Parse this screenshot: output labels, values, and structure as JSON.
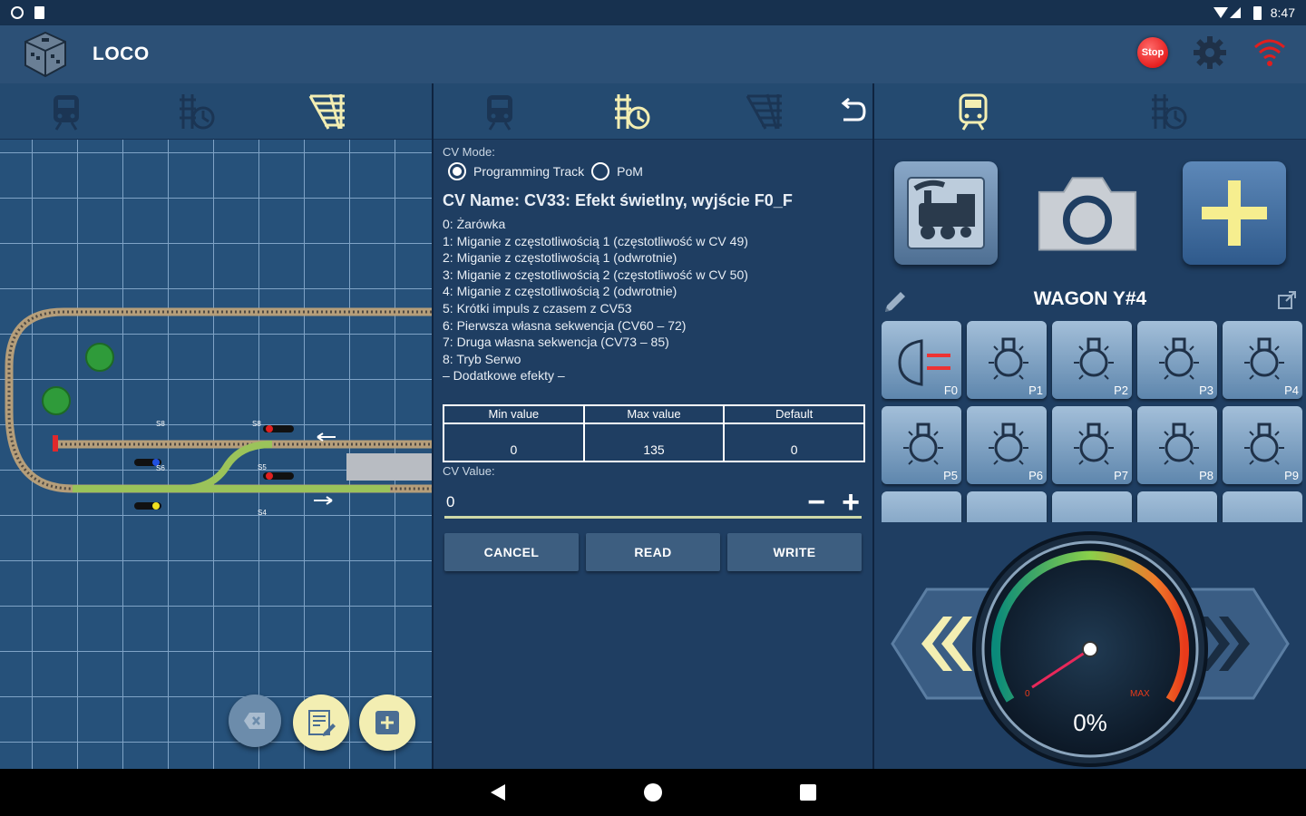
{
  "status_bar": {
    "time": "8:47"
  },
  "app": {
    "title": "LOCO",
    "stop_label": "Stop"
  },
  "icons": {
    "app_logo": "cube-logo-icon",
    "stop": "stop-button-icon",
    "settings": "gear-icon",
    "connection": "wifi-icon",
    "tab_loco": "train-icon",
    "tab_programming": "programming-track-icon",
    "tab_layout": "track-layout-icon",
    "undo": "undo-icon"
  },
  "colors": {
    "accent_yellow": "#f3eeb2",
    "grid_line": "#7fa3c6",
    "stop_red": "#dd0000"
  },
  "cv_panel": {
    "mode_label": "CV Mode:",
    "modes": [
      {
        "label": "Programming Track",
        "selected": true
      },
      {
        "label": "PoM",
        "selected": false
      }
    ],
    "cv_name": "CV Name:  CV33: Efekt świetlny, wyjście F0_F",
    "options": [
      "0: Żarówka",
      "1: Miganie z częstotliwością 1 (częstotliwość w CV 49)",
      "2: Miganie z częstotliwością 1 (odwrotnie)",
      "3: Miganie z częstotliwością 2 (częstotliwość w CV 50)",
      "4: Miganie z częstotliwością 2 (odwrotnie)",
      "5: Krótki impuls z czasem z CV53",
      "6: Pierwsza własna sekwencja (CV60 – 72)",
      "7: Druga własna sekwencja (CV73 – 85)",
      "8: Tryb Serwo",
      "– Dodatkowe efekty –"
    ],
    "table": {
      "headers": [
        "Min value",
        "Max value",
        "Default"
      ],
      "values": [
        "0",
        "135",
        "0"
      ]
    },
    "cv_value_label": "CV Value:",
    "cv_value": "0",
    "minus": "−",
    "plus": "+",
    "buttons": {
      "cancel": "CANCEL",
      "read": "READ",
      "write": "WRITE"
    }
  },
  "loco_panel": {
    "name": "WAGON Y#4",
    "functions": [
      "F0",
      "P1",
      "P2",
      "P3",
      "P4",
      "P5",
      "P6",
      "P7",
      "P8",
      "P9"
    ],
    "speed": "0%",
    "gauge_min": "0",
    "gauge_max": "MAX"
  },
  "layout_labels": {
    "signal_1": "S8",
    "signal_2": "S8",
    "signal_3": "S6",
    "signal_4": "S5",
    "signal_5": "S4"
  }
}
